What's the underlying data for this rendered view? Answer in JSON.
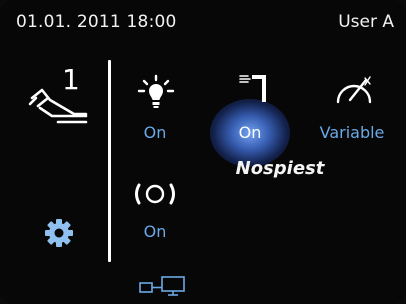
{
  "status": {
    "datetime": "01.01. 2011 18:00",
    "user": "User A"
  },
  "instrument": {
    "number": "1",
    "icon": "dental-handpiece-icon"
  },
  "controls": {
    "light": {
      "icon": "light-bulb-icon",
      "label": "On"
    },
    "spray": {
      "icon": "spray-nozzle-icon",
      "label": "On",
      "caption": "Nospiest"
    },
    "speed": {
      "icon": "speed-gauge-icon",
      "label": "Variable"
    },
    "ring": {
      "icon": "ring-light-icon",
      "label": "On"
    }
  },
  "settings": {
    "icon": "gear-icon"
  },
  "connection": {
    "icon": "network-monitor-icon"
  },
  "colors": {
    "accent": "#6ba8e6",
    "gear": "#8fc0ef",
    "background": "#070707",
    "text": "#f2f2f2",
    "active_glow": "#5a8ff0"
  }
}
